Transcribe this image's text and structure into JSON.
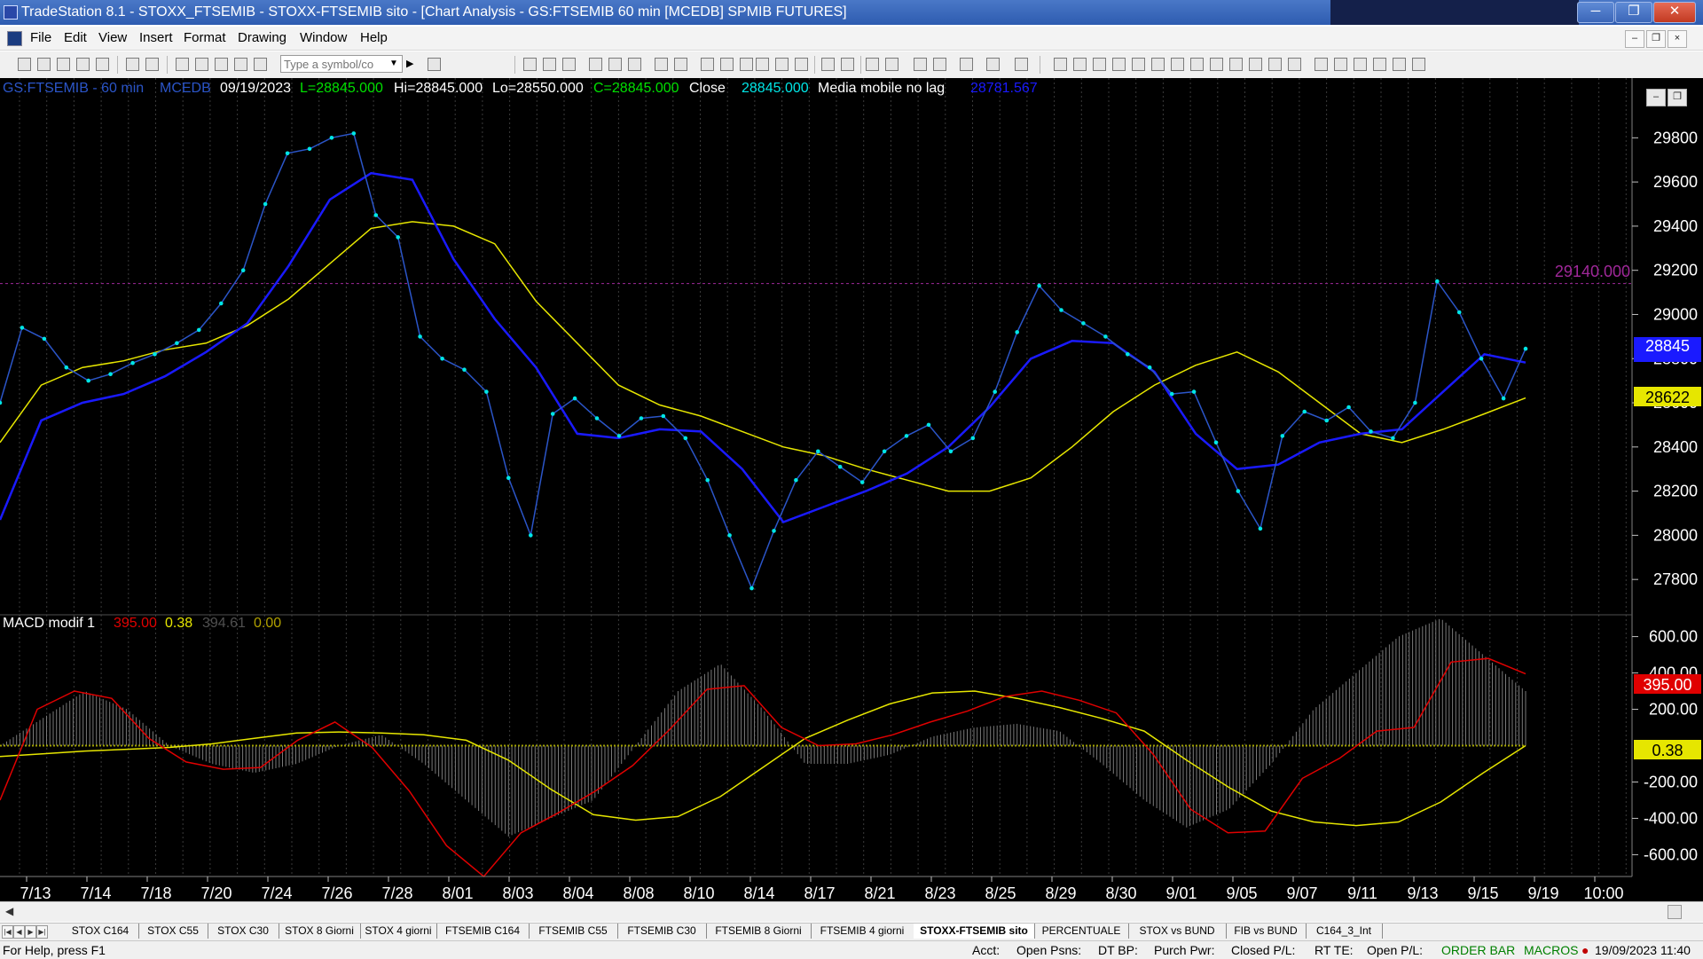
{
  "window": {
    "title": "TradeStation 8.1 - STOXX_FTSEMIB - STOXX-FTSEMIB sito - [Chart Analysis - GS:FTSEMIB  60 min  [MCEDB] SPMIB FUTURES]"
  },
  "menu": [
    "File",
    "Edit",
    "View",
    "Insert",
    "Format",
    "Drawing",
    "Window",
    "Help"
  ],
  "toolbar": {
    "symbol_placeholder": "Type a symbol/co"
  },
  "chart_header": {
    "symbol_interval": "GS:FTSEMIB - 60 min",
    "exchange": "MCEDB",
    "date": "09/19/2023",
    "low_label": "L=28845.000",
    "high_label": "Hi=28845.000",
    "lo_label": "Lo=28550.000",
    "close_label": "C=28845.000",
    "close_word": "Close",
    "close_value": "28845.000",
    "indicator_name": "Media mobile no lag",
    "indicator_value": "28781.567"
  },
  "price_line_label": "29140.000",
  "macd_header": {
    "name": "MACD modif 1",
    "v1": "395.00",
    "v2": "0.38",
    "v3": "394.61",
    "v4": "0.00"
  },
  "colors": {
    "price": "#00e6e6",
    "price_line": "#2b55c8",
    "blue_ma": "#1a1aff",
    "yellow_ma": "#e6e600",
    "macd_red": "#e00000",
    "macd_yellow": "#e6e600",
    "histogram": "#7a7a7a",
    "ref_line": "#a0289a"
  },
  "chart_data": [
    {
      "type": "line",
      "name": "price_panel",
      "x": [
        "7/13",
        "7/14",
        "7/18",
        "7/20",
        "7/24",
        "7/26",
        "7/28",
        "8/01",
        "8/03",
        "8/04",
        "8/08",
        "8/10",
        "8/14",
        "8/17",
        "8/21",
        "8/23",
        "8/25",
        "8/29",
        "8/30",
        "9/01",
        "9/05",
        "9/07",
        "9/11",
        "9/13",
        "9/15",
        "9/19",
        "10:00"
      ],
      "y_ticks": [
        27800,
        28000,
        28200,
        28400,
        28600,
        28800,
        29000,
        29200,
        29400,
        29600,
        29800
      ],
      "ylim": [
        27640,
        29950
      ],
      "reference_line": 29140,
      "last_value_labels": {
        "close": "28845",
        "yellow_ma": "28622",
        "blue_ma_hidden": "28782"
      },
      "series": [
        {
          "values": [
            28600,
            28940,
            28890,
            28760,
            28700,
            28730,
            28780,
            28820,
            28870,
            28930,
            29050,
            29200,
            29500,
            29730,
            29750,
            29800,
            29820,
            29450,
            29350,
            28900,
            28800,
            28750,
            28650,
            28260,
            28000,
            28550,
            28620,
            28530,
            28450,
            28530,
            28540,
            28440,
            28250,
            28000,
            27760,
            28020,
            28250,
            28380,
            28310,
            28240,
            28380,
            28450,
            28500,
            28380,
            28440,
            28650,
            28920,
            29130,
            29020,
            28960,
            28900,
            28820,
            28760,
            28640,
            28650,
            28420,
            28200,
            28030,
            28450,
            28560,
            28520,
            28580,
            28470,
            28440,
            28600,
            29150,
            29010,
            28800,
            28620,
            28845
          ]
        },
        {
          "values": [
            28420,
            28680,
            28760,
            28790,
            28840,
            28870,
            28950,
            29070,
            29230,
            29390,
            29420,
            29400,
            29320,
            29060,
            28870,
            28680,
            28590,
            28540,
            28470,
            28400,
            28360,
            28300,
            28250,
            28200,
            28200,
            28260,
            28400,
            28560,
            28680,
            28770,
            28830,
            28740,
            28600,
            28460,
            28420,
            28480,
            28550,
            28622
          ]
        },
        {
          "values": [
            28070,
            28520,
            28600,
            28640,
            28720,
            28830,
            28960,
            29220,
            29520,
            29640,
            29610,
            29250,
            28980,
            28760,
            28460,
            28440,
            28480,
            28470,
            28300,
            28060,
            28130,
            28200,
            28280,
            28400,
            28580,
            28800,
            28880,
            28870,
            28740,
            28460,
            28300,
            28320,
            28420,
            28460,
            28480,
            28650,
            28820,
            28782
          ]
        }
      ]
    },
    {
      "type": "line",
      "name": "macd_panel",
      "y_ticks": [
        -600,
        -400,
        -200,
        200,
        400,
        600
      ],
      "ylim": [
        -720,
        720
      ],
      "series": [
        {
          "values": [
            -300,
            200,
            300,
            260,
            40,
            -90,
            -130,
            -120,
            30,
            130,
            -10,
            -250,
            -550,
            -720,
            -480,
            -370,
            -250,
            -110,
            90,
            310,
            330,
            100,
            0,
            10,
            60,
            130,
            190,
            270,
            300,
            250,
            180,
            -50,
            -350,
            -480,
            -470,
            -180,
            -70,
            80,
            100,
            460,
            480,
            395
          ]
        },
        {
          "values": [
            -60,
            -45,
            -30,
            -20,
            -10,
            10,
            40,
            70,
            75,
            70,
            60,
            30,
            -80,
            -240,
            -380,
            -410,
            -390,
            -280,
            -120,
            40,
            140,
            230,
            290,
            300,
            260,
            210,
            150,
            80,
            -80,
            -230,
            -360,
            -420,
            -440,
            -420,
            -310,
            -150,
            0
          ]
        },
        {
          "values": [
            0,
            150,
            300,
            200,
            0,
            -100,
            -150,
            -100,
            0,
            60,
            -100,
            -300,
            -500,
            -400,
            -300,
            0,
            300,
            450,
            200,
            -100,
            -100,
            -50,
            50,
            100,
            120,
            80,
            -100,
            -300,
            -450,
            -350,
            -100,
            200,
            400,
            600,
            700,
            500,
            300
          ]
        }
      ]
    }
  ],
  "tabs": [
    "STOX C164",
    "STOX C55",
    "STOX  C30",
    "STOX  8 Giorni",
    "STOX 4 giorni",
    "FTSEMIB C164",
    "FTSEMIB C55",
    "FTSEMIB C30",
    "FTSEMIB  8 Giorni",
    "FTSEMIB  4 giorni",
    "STOXX-FTSEMIB sito",
    "PERCENTUALE",
    "STOX vs BUND",
    "FIB vs BUND",
    "C164_3_Int"
  ],
  "status": {
    "help": "For Help, press F1",
    "acct": "Acct:",
    "open_psns": "Open Psns:",
    "dt_bp": "DT BP:",
    "purch_pwr": "Purch Pwr:",
    "closed_pl": "Closed P/L:",
    "rt_te": "RT TE:",
    "open_pl": "Open P/L:",
    "order_bar": "ORDER BAR",
    "macros": "MACROS",
    "datetime": "19/09/2023 11:40"
  }
}
